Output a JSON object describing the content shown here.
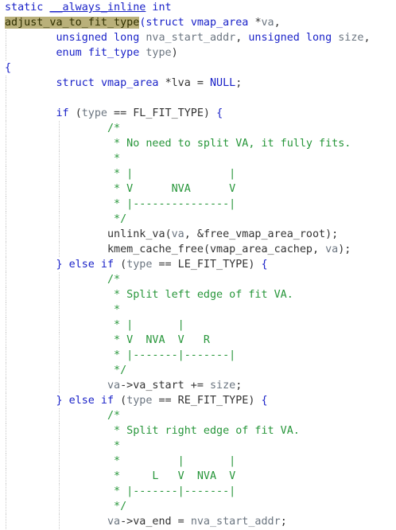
{
  "editor": {
    "language": "C",
    "lines": [
      {
        "indent": 0,
        "tokens": [
          [
            "kw",
            "static "
          ],
          [
            "attr",
            "__always_inline"
          ],
          [
            "kw",
            " int"
          ]
        ]
      },
      {
        "indent": 0,
        "tokens": [
          [
            "hl",
            "adjust_va_to_fit_type"
          ],
          [
            "kw",
            "(struct "
          ],
          [
            "ty",
            "vmap_area "
          ],
          [
            "punc",
            "*"
          ],
          [
            "var",
            "va"
          ],
          [
            "punc",
            ","
          ]
        ]
      },
      {
        "indent": 0,
        "guides": [
          0
        ],
        "tokens": [
          [
            "plain",
            "        "
          ],
          [
            "kw",
            "unsigned long "
          ],
          [
            "var",
            "nva_start_addr"
          ],
          [
            "punc",
            ", "
          ],
          [
            "kw",
            "unsigned long "
          ],
          [
            "var",
            "size"
          ],
          [
            "punc",
            ","
          ]
        ]
      },
      {
        "indent": 0,
        "guides": [
          0
        ],
        "tokens": [
          [
            "plain",
            "        "
          ],
          [
            "kw",
            "enum "
          ],
          [
            "ty",
            "fit_type "
          ],
          [
            "var",
            "type"
          ],
          [
            "punc",
            ")"
          ]
        ]
      },
      {
        "indent": 0,
        "tokens": [
          [
            "brace",
            "{"
          ]
        ]
      },
      {
        "indent": 0,
        "guides": [
          0
        ],
        "tokens": [
          [
            "plain",
            "        "
          ],
          [
            "kw",
            "struct "
          ],
          [
            "ty",
            "vmap_area "
          ],
          [
            "punc",
            "*"
          ],
          [
            "plain",
            "lva = "
          ],
          [
            "mac",
            "NULL"
          ],
          [
            "punc",
            ";"
          ]
        ]
      },
      {
        "indent": 0,
        "guides": [
          0
        ],
        "tokens": []
      },
      {
        "indent": 0,
        "guides": [
          0
        ],
        "tokens": [
          [
            "plain",
            "        "
          ],
          [
            "kw",
            "if "
          ],
          [
            "punc",
            "("
          ],
          [
            "var",
            "type"
          ],
          [
            "plain",
            " == FL_FIT_TYPE) "
          ],
          [
            "brace",
            "{"
          ]
        ]
      },
      {
        "indent": 0,
        "guides": [
          0,
          1
        ],
        "tokens": [
          [
            "plain",
            "                "
          ],
          [
            "cmt",
            "/*"
          ]
        ]
      },
      {
        "indent": 0,
        "guides": [
          0,
          1
        ],
        "tokens": [
          [
            "plain",
            "                "
          ],
          [
            "cmt",
            " * No need to split VA, it fully fits."
          ]
        ]
      },
      {
        "indent": 0,
        "guides": [
          0,
          1
        ],
        "tokens": [
          [
            "plain",
            "                "
          ],
          [
            "cmt",
            " *"
          ]
        ]
      },
      {
        "indent": 0,
        "guides": [
          0,
          1
        ],
        "tokens": [
          [
            "plain",
            "                "
          ],
          [
            "cmt",
            " * |               |"
          ]
        ]
      },
      {
        "indent": 0,
        "guides": [
          0,
          1
        ],
        "tokens": [
          [
            "plain",
            "                "
          ],
          [
            "cmt",
            " * V      NVA      V"
          ]
        ]
      },
      {
        "indent": 0,
        "guides": [
          0,
          1
        ],
        "tokens": [
          [
            "plain",
            "                "
          ],
          [
            "cmt",
            " * |---------------|"
          ]
        ]
      },
      {
        "indent": 0,
        "guides": [
          0,
          1
        ],
        "tokens": [
          [
            "plain",
            "                "
          ],
          [
            "cmt",
            " */"
          ]
        ]
      },
      {
        "indent": 0,
        "guides": [
          0,
          1
        ],
        "tokens": [
          [
            "plain",
            "                "
          ],
          [
            "fn",
            "unlink_va"
          ],
          [
            "punc",
            "("
          ],
          [
            "var",
            "va"
          ],
          [
            "punc",
            ", &"
          ],
          [
            "plain",
            "free_vmap_area_root"
          ],
          [
            "punc",
            ");"
          ]
        ]
      },
      {
        "indent": 0,
        "guides": [
          0,
          1
        ],
        "tokens": [
          [
            "plain",
            "                "
          ],
          [
            "fn",
            "kmem_cache_free"
          ],
          [
            "punc",
            "("
          ],
          [
            "plain",
            "vmap_area_cachep"
          ],
          [
            "punc",
            ", "
          ],
          [
            "var",
            "va"
          ],
          [
            "punc",
            ");"
          ]
        ]
      },
      {
        "indent": 0,
        "guides": [
          0
        ],
        "tokens": [
          [
            "plain",
            "        "
          ],
          [
            "brace",
            "} "
          ],
          [
            "kw",
            "else if "
          ],
          [
            "punc",
            "("
          ],
          [
            "var",
            "type"
          ],
          [
            "plain",
            " == LE_FIT_TYPE) "
          ],
          [
            "brace",
            "{"
          ]
        ]
      },
      {
        "indent": 0,
        "guides": [
          0,
          1
        ],
        "tokens": [
          [
            "plain",
            "                "
          ],
          [
            "cmt",
            "/*"
          ]
        ]
      },
      {
        "indent": 0,
        "guides": [
          0,
          1
        ],
        "tokens": [
          [
            "plain",
            "                "
          ],
          [
            "cmt",
            " * Split left edge of fit VA."
          ]
        ]
      },
      {
        "indent": 0,
        "guides": [
          0,
          1
        ],
        "tokens": [
          [
            "plain",
            "                "
          ],
          [
            "cmt",
            " *"
          ]
        ]
      },
      {
        "indent": 0,
        "guides": [
          0,
          1
        ],
        "tokens": [
          [
            "plain",
            "                "
          ],
          [
            "cmt",
            " * |       |"
          ]
        ]
      },
      {
        "indent": 0,
        "guides": [
          0,
          1
        ],
        "tokens": [
          [
            "plain",
            "                "
          ],
          [
            "cmt",
            " * V  NVA  V   R"
          ]
        ]
      },
      {
        "indent": 0,
        "guides": [
          0,
          1
        ],
        "tokens": [
          [
            "plain",
            "                "
          ],
          [
            "cmt",
            " * |-------|-------|"
          ]
        ]
      },
      {
        "indent": 0,
        "guides": [
          0,
          1
        ],
        "tokens": [
          [
            "plain",
            "                "
          ],
          [
            "cmt",
            " */"
          ]
        ]
      },
      {
        "indent": 0,
        "guides": [
          0,
          1
        ],
        "tokens": [
          [
            "plain",
            "                "
          ],
          [
            "var",
            "va"
          ],
          [
            "plain",
            "->va_start += "
          ],
          [
            "var",
            "size"
          ],
          [
            "punc",
            ";"
          ]
        ]
      },
      {
        "indent": 0,
        "guides": [
          0
        ],
        "tokens": [
          [
            "plain",
            "        "
          ],
          [
            "brace",
            "} "
          ],
          [
            "kw",
            "else if "
          ],
          [
            "punc",
            "("
          ],
          [
            "var",
            "type"
          ],
          [
            "plain",
            " == RE_FIT_TYPE) "
          ],
          [
            "brace",
            "{"
          ]
        ]
      },
      {
        "indent": 0,
        "guides": [
          0,
          1
        ],
        "tokens": [
          [
            "plain",
            "                "
          ],
          [
            "cmt",
            "/*"
          ]
        ]
      },
      {
        "indent": 0,
        "guides": [
          0,
          1
        ],
        "tokens": [
          [
            "plain",
            "                "
          ],
          [
            "cmt",
            " * Split right edge of fit VA."
          ]
        ]
      },
      {
        "indent": 0,
        "guides": [
          0,
          1
        ],
        "tokens": [
          [
            "plain",
            "                "
          ],
          [
            "cmt",
            " *"
          ]
        ]
      },
      {
        "indent": 0,
        "guides": [
          0,
          1
        ],
        "tokens": [
          [
            "plain",
            "                "
          ],
          [
            "cmt",
            " *         |       |"
          ]
        ]
      },
      {
        "indent": 0,
        "guides": [
          0,
          1
        ],
        "tokens": [
          [
            "plain",
            "                "
          ],
          [
            "cmt",
            " *     L   V  NVA  V"
          ]
        ]
      },
      {
        "indent": 0,
        "guides": [
          0,
          1
        ],
        "tokens": [
          [
            "plain",
            "                "
          ],
          [
            "cmt",
            " * |-------|-------|"
          ]
        ]
      },
      {
        "indent": 0,
        "guides": [
          0,
          1
        ],
        "tokens": [
          [
            "plain",
            "                "
          ],
          [
            "cmt",
            " */"
          ]
        ]
      },
      {
        "indent": 0,
        "guides": [
          0,
          1
        ],
        "tokens": [
          [
            "plain",
            "                "
          ],
          [
            "var",
            "va"
          ],
          [
            "plain",
            "->va_end = "
          ],
          [
            "var",
            "nva_start_addr"
          ],
          [
            "punc",
            ";"
          ]
        ]
      }
    ]
  }
}
